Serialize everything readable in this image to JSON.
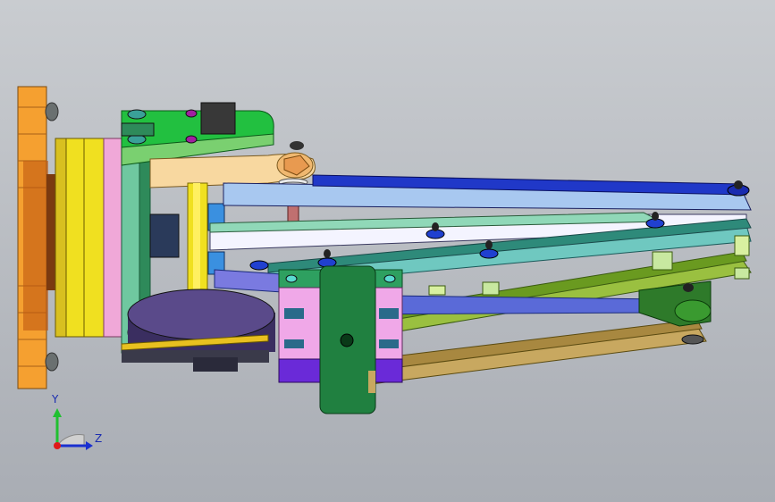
{
  "viewport": {
    "background_top": "#c9ccd0",
    "background_bottom": "#a9adb4"
  },
  "triad": {
    "y_label": "Y",
    "z_label": "Z",
    "y_color": "#20c030",
    "z_color": "#1a30d0",
    "x_color": "#e01818"
  },
  "colors": {
    "flange": "#f5a030",
    "bearing": "#f0e020",
    "pink": "#f0a8d8",
    "green_plate": "#22c040",
    "teal": "#6fc8c0",
    "blue_link": "#2038c8",
    "light_blue_link": "#a8c8f0",
    "olive_link": "#9ac040",
    "tan_link": "#c8a860",
    "purple": "#4a3a7a",
    "dark_green_block": "#208040"
  }
}
